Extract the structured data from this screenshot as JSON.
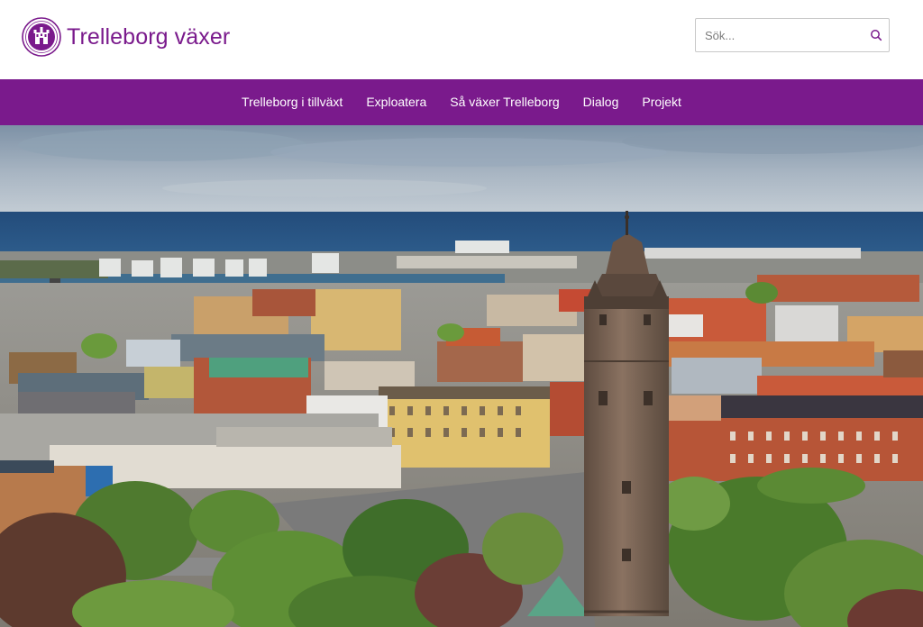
{
  "site": {
    "title": "Trelleborg växer",
    "logo_icon": "city-coat-of-arms-icon"
  },
  "search": {
    "placeholder": "Sök...",
    "value": "",
    "icon": "search-icon"
  },
  "nav": {
    "items": [
      {
        "label": "Trelleborg i tillväxt"
      },
      {
        "label": "Exploatera"
      },
      {
        "label": "Så växer Trelleborg"
      },
      {
        "label": "Dialog"
      },
      {
        "label": "Projekt"
      }
    ]
  },
  "colors": {
    "brand": "#7a1a8c",
    "nav_text": "#ffffff",
    "header_bg": "#ffffff"
  },
  "hero": {
    "subject": "aerial-city-photo-with-water-tower"
  }
}
